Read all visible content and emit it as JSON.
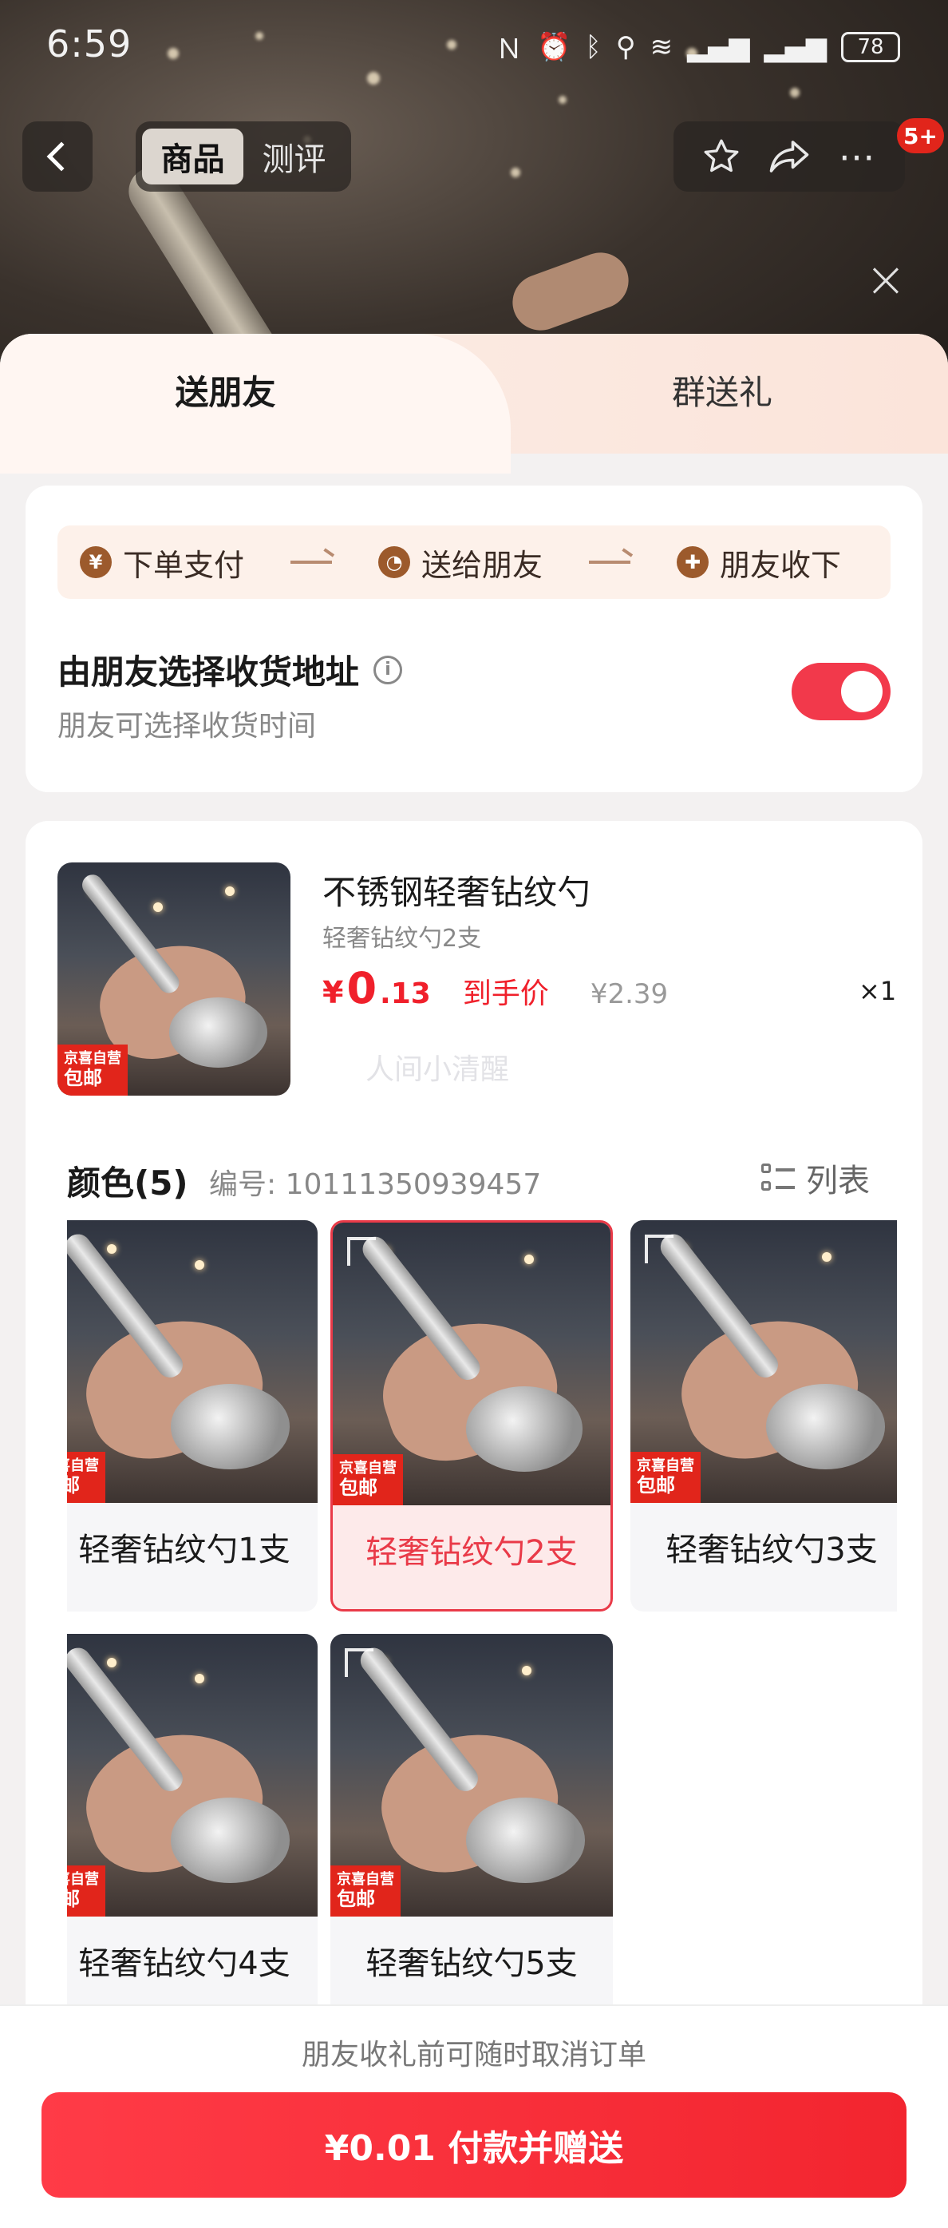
{
  "status_bar": {
    "time": "6:59",
    "battery": "78"
  },
  "nav": {
    "tabs": [
      {
        "label": "商品",
        "active": true
      },
      {
        "label": "测评",
        "active": false
      }
    ],
    "badge": "5+"
  },
  "sheet": {
    "tabs": {
      "left": "送朋友",
      "right": "群送礼"
    },
    "flow": {
      "steps": [
        {
          "icon": "yen-icon",
          "label": "下单支付"
        },
        {
          "icon": "wechat-icon",
          "label": "送给朋友"
        },
        {
          "icon": "gift-icon",
          "label": "朋友收下"
        }
      ]
    },
    "address": {
      "title": "由朋友选择收货地址",
      "subtitle": "朋友可选择收货时间",
      "toggle_on": true
    },
    "product": {
      "name": "不锈钢轻奢钻纹勺",
      "variant": "轻奢钻纹勺2支",
      "price_currency": "¥",
      "price_integer": "0",
      "price_decimal": ".13",
      "price_tag": "到手价",
      "original_price": "¥2.39",
      "quantity": "×1",
      "thumb_badge_top": "京喜自营",
      "thumb_badge_bottom": "包邮",
      "watermark": "人间小清醒"
    },
    "color_section": {
      "title": "颜色(5)",
      "sku": "编号: 10111350939457",
      "list_label": "列表"
    },
    "variants": [
      {
        "label": "轻奢钻纹勺1支",
        "selected": false
      },
      {
        "label": "轻奢钻纹勺2支",
        "selected": true
      },
      {
        "label": "轻奢钻纹勺3支",
        "selected": false
      },
      {
        "label": "轻奢钻纹勺4支",
        "selected": false
      },
      {
        "label": "轻奢钻纹勺5支",
        "selected": false
      }
    ],
    "bottom": {
      "note": "朋友收礼前可随时取消订单",
      "pay_label": "¥0.01 付款并赠送"
    }
  },
  "colors": {
    "accent": "#f2252f",
    "selected_border": "#e93a48"
  }
}
